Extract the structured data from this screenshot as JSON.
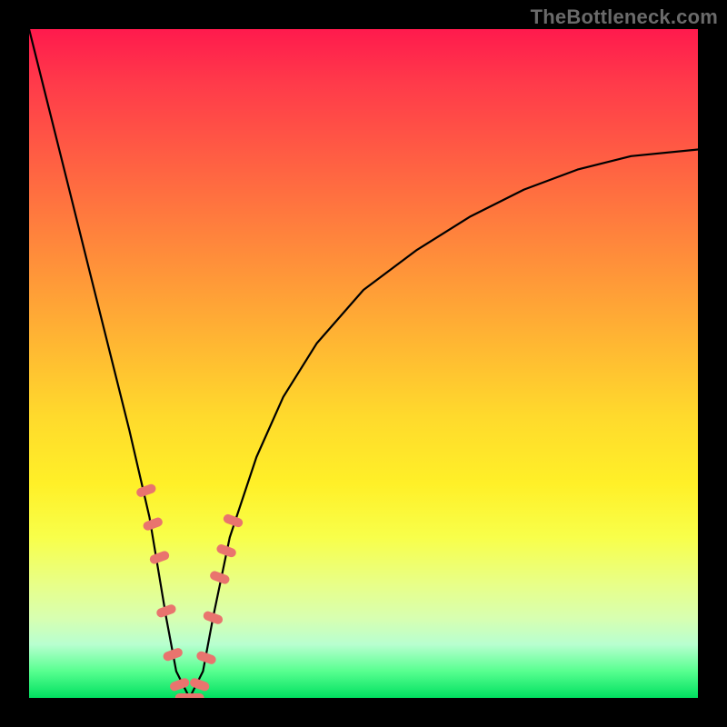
{
  "watermark": "TheBottleneck.com",
  "colors": {
    "marker": "#e9746e",
    "curve": "#000000",
    "frame_bg_top": "#ff1a4d",
    "frame_bg_bottom": "#00e060",
    "page_bg": "#000000"
  },
  "chart_data": {
    "type": "line",
    "title": "",
    "xlabel": "",
    "ylabel": "",
    "xlim": [
      0,
      1
    ],
    "ylim": [
      0,
      1
    ],
    "note": "Axes are unitless (no tick labels in source). x spans the plot width, y is the curve height as fraction of plot height. The curve is an asymmetric V reaching y≈0 near x≈0.24 then rising toward y≈0.82 at x=1.",
    "series": [
      {
        "name": "bottleneck-curve",
        "x": [
          0.0,
          0.03,
          0.06,
          0.09,
          0.12,
          0.15,
          0.18,
          0.205,
          0.22,
          0.24,
          0.26,
          0.275,
          0.3,
          0.34,
          0.38,
          0.43,
          0.5,
          0.58,
          0.66,
          0.74,
          0.82,
          0.9,
          1.0
        ],
        "y": [
          1.0,
          0.88,
          0.76,
          0.64,
          0.52,
          0.4,
          0.27,
          0.12,
          0.04,
          0.0,
          0.04,
          0.12,
          0.24,
          0.36,
          0.45,
          0.53,
          0.61,
          0.67,
          0.72,
          0.76,
          0.79,
          0.81,
          0.82
        ]
      }
    ],
    "markers": {
      "name": "highlight-points",
      "note": "Salmon pill markers near the V vertex on both arms and along the flat minimum.",
      "x": [
        0.175,
        0.185,
        0.195,
        0.205,
        0.215,
        0.225,
        0.255,
        0.265,
        0.275,
        0.285,
        0.295,
        0.305
      ],
      "y": [
        0.31,
        0.26,
        0.21,
        0.13,
        0.065,
        0.02,
        0.02,
        0.06,
        0.12,
        0.18,
        0.22,
        0.265
      ]
    },
    "flat_segment": {
      "x0": 0.225,
      "x1": 0.255,
      "y": 0.0
    }
  }
}
